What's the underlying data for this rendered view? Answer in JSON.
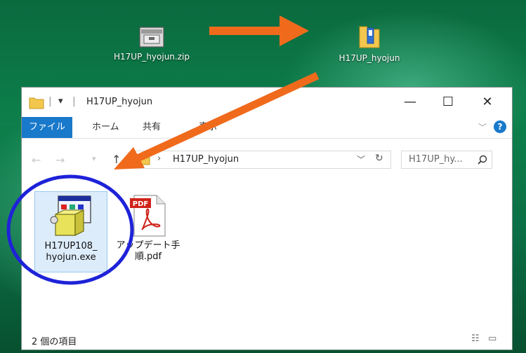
{
  "desktop": {
    "icons": [
      {
        "label": "H17UP_hyojun.zip",
        "icon": "zip-archive-icon"
      },
      {
        "label": "H17UP_hyojun",
        "icon": "folder-icon"
      }
    ]
  },
  "window": {
    "title": "H17UP_hyojun",
    "ribbon_tabs": [
      "ファイル",
      "ホーム",
      "共有",
      "表示"
    ],
    "address": "H17UP_hyojun",
    "search_placeholder": "H17UP_hy...",
    "files": [
      {
        "name_line1": "H17UP108_",
        "name_line2": "hyojun.exe",
        "icon": "installer-exe-icon"
      },
      {
        "name_line1": "アップデート手",
        "name_line2": "順.pdf",
        "icon": "pdf-icon",
        "badge": "PDF"
      }
    ],
    "status": "2 個の項目"
  },
  "colors": {
    "accent": "#1979ca",
    "arrow": "#f06a1c",
    "highlight_circle": "#1e22d8"
  }
}
